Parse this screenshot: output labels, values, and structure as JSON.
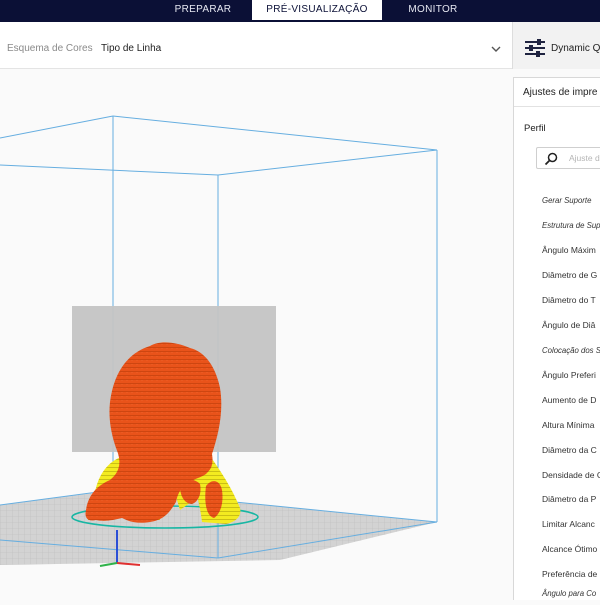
{
  "header": {
    "tabs": [
      {
        "label": "PREPARAR",
        "active": false
      },
      {
        "label": "PRÉ-VISUALIZAÇÃO",
        "active": true
      },
      {
        "label": "MONITOR",
        "active": false
      }
    ]
  },
  "view_bar": {
    "color_scheme_label": "Esquema de Cores",
    "color_scheme_value": "Tipo de Linha"
  },
  "profile_bar": {
    "profile_name": "Dynamic Q"
  },
  "panel": {
    "title": "Ajustes de impre",
    "section_label": "Perfil",
    "search_placeholder": "Ajuste d",
    "settings": [
      {
        "label": "Gerar Suporte",
        "italic": true
      },
      {
        "label": "Estrutura de Sup",
        "italic": true
      },
      {
        "label": "Ângulo Máxim",
        "italic": false
      },
      {
        "label": "Diâmetro de G",
        "italic": false
      },
      {
        "label": "Diâmetro do T",
        "italic": false
      },
      {
        "label": "Ângulo de Diâ",
        "italic": false
      },
      {
        "label": "Colocação dos S",
        "italic": true
      },
      {
        "label": "Ângulo Preferi",
        "italic": false
      },
      {
        "label": "Aumento de D",
        "italic": false
      },
      {
        "label": "Altura Mínima",
        "italic": false
      },
      {
        "label": "Diâmetro da C",
        "italic": false
      },
      {
        "label": "Densidade de C",
        "italic": false
      },
      {
        "label": "Diâmetro da P",
        "italic": false
      },
      {
        "label": "Limitar Alcanc",
        "italic": false
      },
      {
        "label": "Alcance Ótimo",
        "italic": false
      },
      {
        "label": "Preferência de",
        "italic": false
      },
      {
        "label": "Ângulo para Co",
        "italic": true
      }
    ]
  },
  "colors": {
    "header_bg": "#0b1036",
    "build_volume_edge": "#5aa8e0",
    "bed": "#cfcfcf",
    "model_wall": "#e94e12",
    "support": "#f2ea1e",
    "skirt": "#16b7a4",
    "prime_tower": "#c3c3c3"
  }
}
